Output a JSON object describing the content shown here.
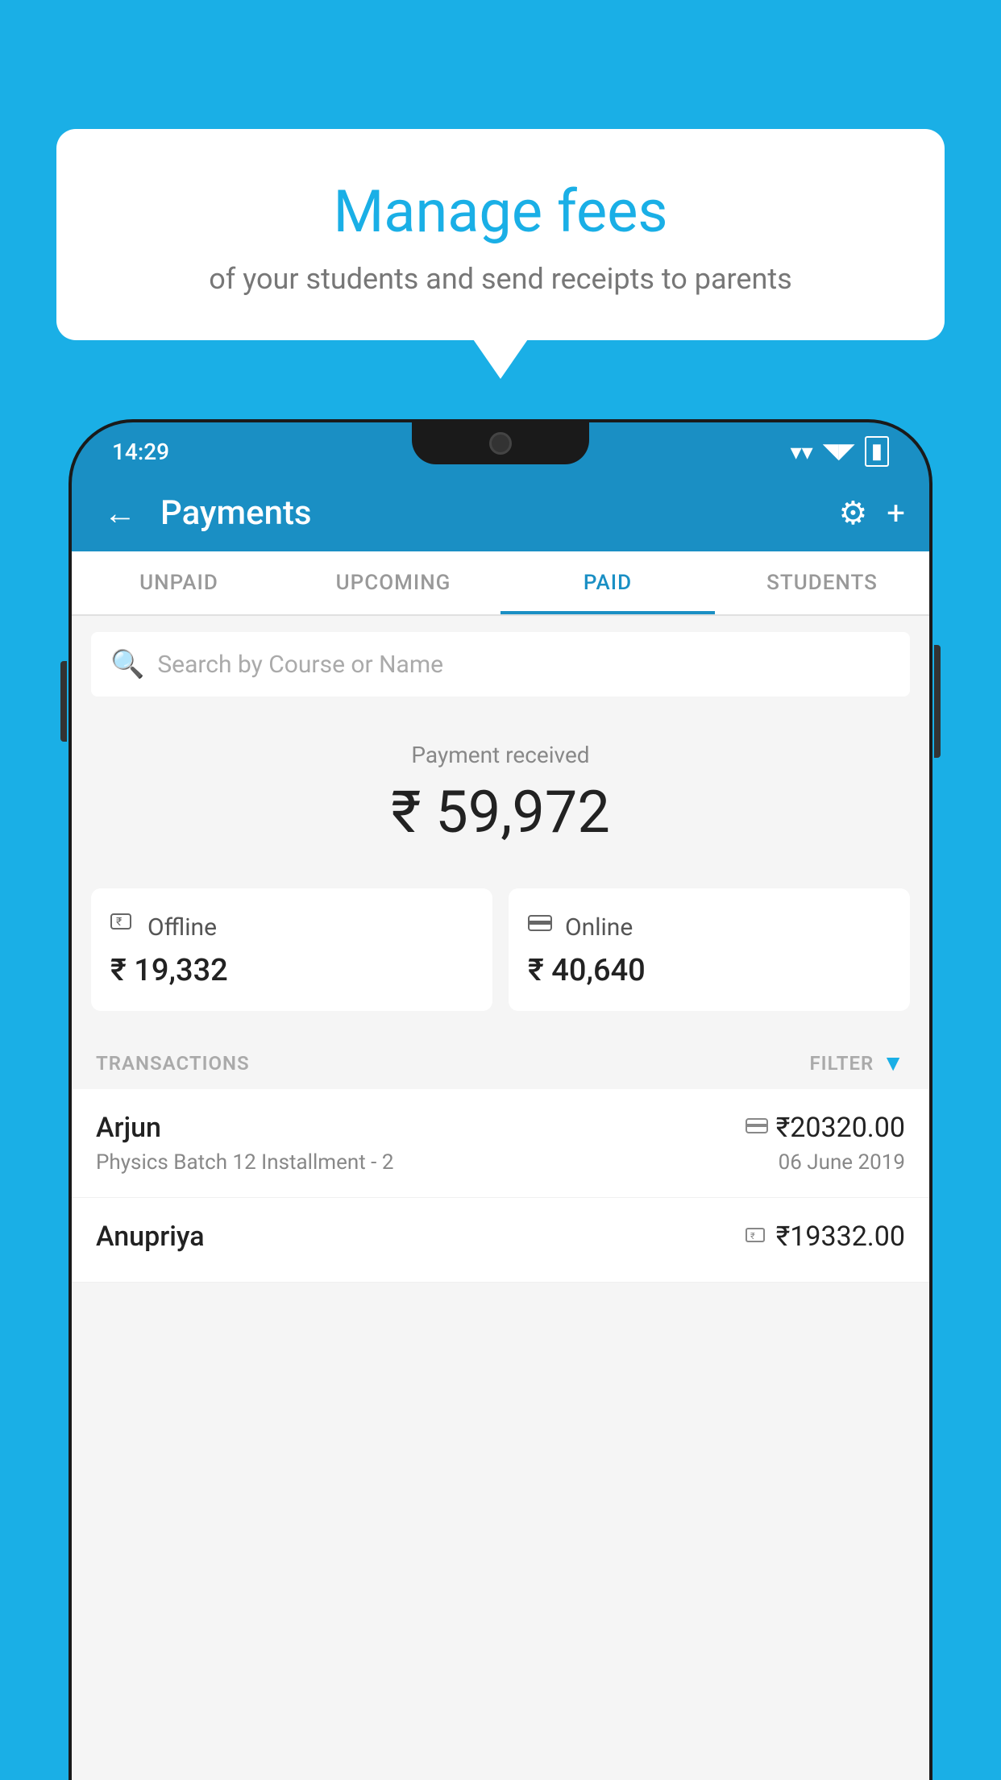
{
  "background_color": "#1AAFE6",
  "bubble": {
    "title": "Manage fees",
    "subtitle": "of your students and send receipts to parents"
  },
  "status_bar": {
    "time": "14:29",
    "wifi": "▼",
    "signal": "▲",
    "battery": "▮"
  },
  "app_bar": {
    "title": "Payments",
    "back_label": "←",
    "gear_label": "⚙",
    "plus_label": "+"
  },
  "tabs": [
    {
      "label": "UNPAID",
      "active": false
    },
    {
      "label": "UPCOMING",
      "active": false
    },
    {
      "label": "PAID",
      "active": true
    },
    {
      "label": "STUDENTS",
      "active": false
    }
  ],
  "search": {
    "placeholder": "Search by Course or Name"
  },
  "payment_received": {
    "label": "Payment received",
    "amount": "₹ 59,972"
  },
  "payment_cards": [
    {
      "icon": "offline",
      "label": "Offline",
      "amount": "₹ 19,332"
    },
    {
      "icon": "online",
      "label": "Online",
      "amount": "₹ 40,640"
    }
  ],
  "transactions": {
    "label": "TRANSACTIONS",
    "filter_label": "FILTER"
  },
  "transaction_rows": [
    {
      "name": "Arjun",
      "method_icon": "card",
      "amount": "₹20320.00",
      "description": "Physics Batch 12 Installment - 2",
      "date": "06 June 2019"
    },
    {
      "name": "Anupriya",
      "method_icon": "offline",
      "amount": "₹19332.00",
      "description": "",
      "date": ""
    }
  ]
}
